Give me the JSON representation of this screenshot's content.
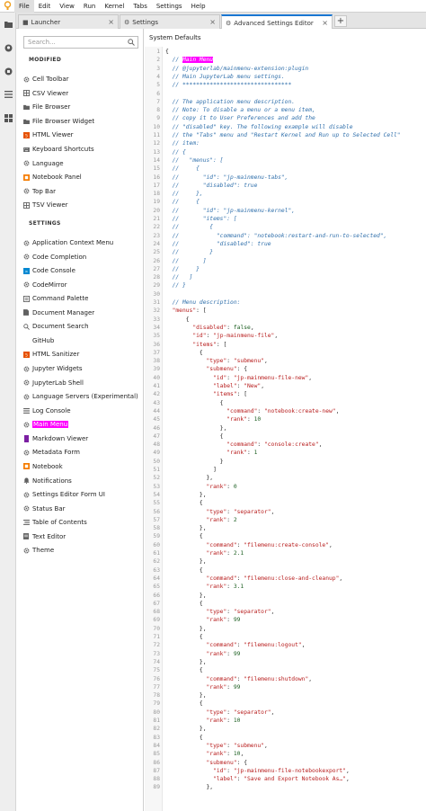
{
  "menubar": {
    "items": [
      "File",
      "Edit",
      "View",
      "Run",
      "Kernel",
      "Tabs",
      "Settings",
      "Help"
    ]
  },
  "rail": {
    "icons": [
      "folder-icon",
      "git-icon",
      "running-icon",
      "toc-icon",
      "extensions-icon"
    ]
  },
  "tabs": [
    {
      "label": "Launcher",
      "icon": "launcher-icon"
    },
    {
      "label": "Settings",
      "icon": "gear-icon"
    },
    {
      "label": "Advanced Settings Editor",
      "icon": "gear-icon"
    }
  ],
  "sidebar": {
    "search_placeholder": "Search...",
    "modified_title": "MODIFIED",
    "modified_items": [
      {
        "label": "Cell Toolbar",
        "icon": "gear-icon"
      },
      {
        "label": "CSV Viewer",
        "icon": "grid-icon"
      },
      {
        "label": "File Browser",
        "icon": "folder-icon"
      },
      {
        "label": "File Browser Widget",
        "icon": "folder-icon"
      },
      {
        "label": "HTML Viewer",
        "icon": "html-icon"
      },
      {
        "label": "Keyboard Shortcuts",
        "icon": "keyboard-icon"
      },
      {
        "label": "Language",
        "icon": "gear-icon"
      },
      {
        "label": "Notebook Panel",
        "icon": "notebook-icon"
      },
      {
        "label": "Top Bar",
        "icon": "gear-icon"
      },
      {
        "label": "TSV Viewer",
        "icon": "grid-icon"
      }
    ],
    "settings_title": "SETTINGS",
    "settings_items": [
      {
        "label": "Application Context Menu",
        "icon": "gear-icon"
      },
      {
        "label": "Code Completion",
        "icon": "gear-icon"
      },
      {
        "label": "Code Console",
        "icon": "console-icon"
      },
      {
        "label": "CodeMirror",
        "icon": "gear-icon"
      },
      {
        "label": "Command Palette",
        "icon": "palette-icon"
      },
      {
        "label": "Document Manager",
        "icon": "file-icon"
      },
      {
        "label": "Document Search",
        "icon": "search-icon"
      },
      {
        "label": "GitHub",
        "icon": ""
      },
      {
        "label": "HTML Sanitizer",
        "icon": "html-icon"
      },
      {
        "label": "Jupyter Widgets",
        "icon": "gear-icon"
      },
      {
        "label": "JupyterLab Shell",
        "icon": "gear-icon"
      },
      {
        "label": "Language Servers (Experimental)",
        "icon": "gear-icon"
      },
      {
        "label": "Log Console",
        "icon": "list-icon"
      },
      {
        "label": "Main Menu",
        "icon": "gear-icon",
        "highlight": true
      },
      {
        "label": "Markdown Viewer",
        "icon": "markdown-icon"
      },
      {
        "label": "Metadata Form",
        "icon": "gear-icon"
      },
      {
        "label": "Notebook",
        "icon": "notebook-icon"
      },
      {
        "label": "Notifications",
        "icon": "bell-icon"
      },
      {
        "label": "Settings Editor Form UI",
        "icon": "gear-icon"
      },
      {
        "label": "Status Bar",
        "icon": "gear-icon"
      },
      {
        "label": "Table of Contents",
        "icon": "toc-icon"
      },
      {
        "label": "Text Editor",
        "icon": "text-icon"
      },
      {
        "label": "Theme",
        "icon": "gear-icon"
      }
    ]
  },
  "editor": {
    "title": "System Defaults",
    "lines": [
      [
        [
          "p",
          "{"
        ]
      ],
      [
        [
          "p",
          "  "
        ],
        [
          "c",
          "// "
        ],
        [
          "hl",
          "Main Menu"
        ]
      ],
      [
        [
          "c",
          "  // @jupyterlab/mainmenu-extension:plugin"
        ]
      ],
      [
        [
          "c",
          "  // Main JupyterLab menu settings."
        ]
      ],
      [
        [
          "c",
          "  // ********************************"
        ]
      ],
      [
        [
          "p",
          ""
        ]
      ],
      [
        [
          "c",
          "  // The application menu description."
        ]
      ],
      [
        [
          "c",
          "  // Note: To disable a menu or a menu item,"
        ]
      ],
      [
        [
          "c",
          "  // copy it to User Preferences and add the"
        ]
      ],
      [
        [
          "c",
          "  // \"disabled\" key. The following example will disable"
        ]
      ],
      [
        [
          "c",
          "  // the \"Tabs\" menu and \"Restart Kernel and Run up to Selected Cell\""
        ]
      ],
      [
        [
          "c",
          "  // item:"
        ]
      ],
      [
        [
          "c",
          "  // {"
        ]
      ],
      [
        [
          "c",
          "  //   \"menus\": ["
        ]
      ],
      [
        [
          "c",
          "  //     {"
        ]
      ],
      [
        [
          "c",
          "  //       \"id\": \"jp-mainmenu-tabs\","
        ]
      ],
      [
        [
          "c",
          "  //       \"disabled\": true"
        ]
      ],
      [
        [
          "c",
          "  //     },"
        ]
      ],
      [
        [
          "c",
          "  //     {"
        ]
      ],
      [
        [
          "c",
          "  //       \"id\": \"jp-mainmenu-kernel\","
        ]
      ],
      [
        [
          "c",
          "  //       \"items\": ["
        ]
      ],
      [
        [
          "c",
          "  //         {"
        ]
      ],
      [
        [
          "c",
          "  //           \"command\": \"notebook:restart-and-run-to-selected\","
        ]
      ],
      [
        [
          "c",
          "  //           \"disabled\": true"
        ]
      ],
      [
        [
          "c",
          "  //         }"
        ]
      ],
      [
        [
          "c",
          "  //       ]"
        ]
      ],
      [
        [
          "c",
          "  //     }"
        ]
      ],
      [
        [
          "c",
          "  //   ]"
        ]
      ],
      [
        [
          "c",
          "  // }"
        ]
      ],
      [
        [
          "p",
          ""
        ]
      ],
      [
        [
          "c",
          "  // Menu description:"
        ]
      ],
      [
        [
          "p",
          "  "
        ],
        [
          "s",
          "\"menus\""
        ],
        [
          "p",
          ": ["
        ]
      ],
      [
        [
          "p",
          "      {"
        ]
      ],
      [
        [
          "p",
          "        "
        ],
        [
          "s",
          "\"disabled\""
        ],
        [
          "p",
          ": "
        ],
        [
          "k",
          "false"
        ],
        [
          "p",
          ","
        ]
      ],
      [
        [
          "p",
          "        "
        ],
        [
          "s",
          "\"id\""
        ],
        [
          "p",
          ": "
        ],
        [
          "s",
          "\"jp-mainmenu-file\""
        ],
        [
          "p",
          ","
        ]
      ],
      [
        [
          "p",
          "        "
        ],
        [
          "s",
          "\"items\""
        ],
        [
          "p",
          ": ["
        ]
      ],
      [
        [
          "p",
          "          {"
        ]
      ],
      [
        [
          "p",
          "            "
        ],
        [
          "s",
          "\"type\""
        ],
        [
          "p",
          ": "
        ],
        [
          "s",
          "\"submenu\""
        ],
        [
          "p",
          ","
        ]
      ],
      [
        [
          "p",
          "            "
        ],
        [
          "s",
          "\"submenu\""
        ],
        [
          "p",
          ": {"
        ]
      ],
      [
        [
          "p",
          "              "
        ],
        [
          "s",
          "\"id\""
        ],
        [
          "p",
          ": "
        ],
        [
          "s",
          "\"jp-mainmenu-file-new\""
        ],
        [
          "p",
          ","
        ]
      ],
      [
        [
          "p",
          "              "
        ],
        [
          "s",
          "\"label\""
        ],
        [
          "p",
          ": "
        ],
        [
          "s",
          "\"New\""
        ],
        [
          "p",
          ","
        ]
      ],
      [
        [
          "p",
          "              "
        ],
        [
          "s",
          "\"items\""
        ],
        [
          "p",
          ": ["
        ]
      ],
      [
        [
          "p",
          "                {"
        ]
      ],
      [
        [
          "p",
          "                  "
        ],
        [
          "s",
          "\"command\""
        ],
        [
          "p",
          ": "
        ],
        [
          "s",
          "\"notebook:create-new\""
        ],
        [
          "p",
          ","
        ]
      ],
      [
        [
          "p",
          "                  "
        ],
        [
          "s",
          "\"rank\""
        ],
        [
          "p",
          ": "
        ],
        [
          "n",
          "10"
        ]
      ],
      [
        [
          "p",
          "                },"
        ]
      ],
      [
        [
          "p",
          "                {"
        ]
      ],
      [
        [
          "p",
          "                  "
        ],
        [
          "s",
          "\"command\""
        ],
        [
          "p",
          ": "
        ],
        [
          "s",
          "\"console:create\""
        ],
        [
          "p",
          ","
        ]
      ],
      [
        [
          "p",
          "                  "
        ],
        [
          "s",
          "\"rank\""
        ],
        [
          "p",
          ": "
        ],
        [
          "n",
          "1"
        ]
      ],
      [
        [
          "p",
          "                }"
        ]
      ],
      [
        [
          "p",
          "              ]"
        ]
      ],
      [
        [
          "p",
          "            },"
        ]
      ],
      [
        [
          "p",
          "            "
        ],
        [
          "s",
          "\"rank\""
        ],
        [
          "p",
          ": "
        ],
        [
          "n",
          "0"
        ]
      ],
      [
        [
          "p",
          "          },"
        ]
      ],
      [
        [
          "p",
          "          {"
        ]
      ],
      [
        [
          "p",
          "            "
        ],
        [
          "s",
          "\"type\""
        ],
        [
          "p",
          ": "
        ],
        [
          "s",
          "\"separator\""
        ],
        [
          "p",
          ","
        ]
      ],
      [
        [
          "p",
          "            "
        ],
        [
          "s",
          "\"rank\""
        ],
        [
          "p",
          ": "
        ],
        [
          "n",
          "2"
        ]
      ],
      [
        [
          "p",
          "          },"
        ]
      ],
      [
        [
          "p",
          "          {"
        ]
      ],
      [
        [
          "p",
          "            "
        ],
        [
          "s",
          "\"command\""
        ],
        [
          "p",
          ": "
        ],
        [
          "s",
          "\"filemenu:create-console\""
        ],
        [
          "p",
          ","
        ]
      ],
      [
        [
          "p",
          "            "
        ],
        [
          "s",
          "\"rank\""
        ],
        [
          "p",
          ": "
        ],
        [
          "n",
          "2.1"
        ]
      ],
      [
        [
          "p",
          "          },"
        ]
      ],
      [
        [
          "p",
          "          {"
        ]
      ],
      [
        [
          "p",
          "            "
        ],
        [
          "s",
          "\"command\""
        ],
        [
          "p",
          ": "
        ],
        [
          "s",
          "\"filemenu:close-and-cleanup\""
        ],
        [
          "p",
          ","
        ]
      ],
      [
        [
          "p",
          "            "
        ],
        [
          "s",
          "\"rank\""
        ],
        [
          "p",
          ": "
        ],
        [
          "n",
          "3.1"
        ]
      ],
      [
        [
          "p",
          "          },"
        ]
      ],
      [
        [
          "p",
          "          {"
        ]
      ],
      [
        [
          "p",
          "            "
        ],
        [
          "s",
          "\"type\""
        ],
        [
          "p",
          ": "
        ],
        [
          "s",
          "\"separator\""
        ],
        [
          "p",
          ","
        ]
      ],
      [
        [
          "p",
          "            "
        ],
        [
          "s",
          "\"rank\""
        ],
        [
          "p",
          ": "
        ],
        [
          "n",
          "99"
        ]
      ],
      [
        [
          "p",
          "          },"
        ]
      ],
      [
        [
          "p",
          "          {"
        ]
      ],
      [
        [
          "p",
          "            "
        ],
        [
          "s",
          "\"command\""
        ],
        [
          "p",
          ": "
        ],
        [
          "s",
          "\"filemenu:logout\""
        ],
        [
          "p",
          ","
        ]
      ],
      [
        [
          "p",
          "            "
        ],
        [
          "s",
          "\"rank\""
        ],
        [
          "p",
          ": "
        ],
        [
          "n",
          "99"
        ]
      ],
      [
        [
          "p",
          "          },"
        ]
      ],
      [
        [
          "p",
          "          {"
        ]
      ],
      [
        [
          "p",
          "            "
        ],
        [
          "s",
          "\"command\""
        ],
        [
          "p",
          ": "
        ],
        [
          "s",
          "\"filemenu:shutdown\""
        ],
        [
          "p",
          ","
        ]
      ],
      [
        [
          "p",
          "            "
        ],
        [
          "s",
          "\"rank\""
        ],
        [
          "p",
          ": "
        ],
        [
          "n",
          "99"
        ]
      ],
      [
        [
          "p",
          "          },"
        ]
      ],
      [
        [
          "p",
          "          {"
        ]
      ],
      [
        [
          "p",
          "            "
        ],
        [
          "s",
          "\"type\""
        ],
        [
          "p",
          ": "
        ],
        [
          "s",
          "\"separator\""
        ],
        [
          "p",
          ","
        ]
      ],
      [
        [
          "p",
          "            "
        ],
        [
          "s",
          "\"rank\""
        ],
        [
          "p",
          ": "
        ],
        [
          "n",
          "10"
        ]
      ],
      [
        [
          "p",
          "          },"
        ]
      ],
      [
        [
          "p",
          "          {"
        ]
      ],
      [
        [
          "p",
          "            "
        ],
        [
          "s",
          "\"type\""
        ],
        [
          "p",
          ": "
        ],
        [
          "s",
          "\"submenu\""
        ],
        [
          "p",
          ","
        ]
      ],
      [
        [
          "p",
          "            "
        ],
        [
          "s",
          "\"rank\""
        ],
        [
          "p",
          ": "
        ],
        [
          "n",
          "10"
        ],
        [
          "p",
          ","
        ]
      ],
      [
        [
          "p",
          "            "
        ],
        [
          "s",
          "\"submenu\""
        ],
        [
          "p",
          ": {"
        ]
      ],
      [
        [
          "p",
          "              "
        ],
        [
          "s",
          "\"id\""
        ],
        [
          "p",
          ": "
        ],
        [
          "s",
          "\"jp-mainmenu-file-notebookexport\""
        ],
        [
          "p",
          ","
        ]
      ],
      [
        [
          "p",
          "              "
        ],
        [
          "s",
          "\"label\""
        ],
        [
          "p",
          ": "
        ],
        [
          "s",
          "\"Save and Export Notebook As…\""
        ],
        [
          "p",
          ","
        ]
      ],
      [
        [
          "p",
          "            },"
        ]
      ]
    ]
  }
}
